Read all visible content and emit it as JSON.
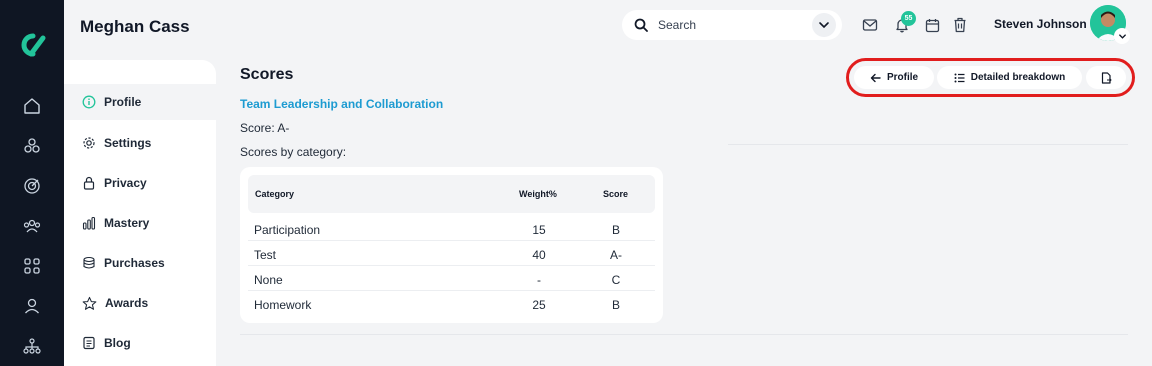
{
  "header": {
    "page_owner": "Meghan Cass",
    "search_placeholder": "Search",
    "notification_count": "55",
    "user_name": "Steven Johnson"
  },
  "subnav": {
    "items": [
      {
        "label": "Profile",
        "icon": "info-icon"
      },
      {
        "label": "Settings",
        "icon": "gear-icon"
      },
      {
        "label": "Privacy",
        "icon": "lock-icon"
      },
      {
        "label": "Mastery",
        "icon": "bar-chart-icon"
      },
      {
        "label": "Purchases",
        "icon": "coins-icon"
      },
      {
        "label": "Awards",
        "icon": "star-icon"
      },
      {
        "label": "Blog",
        "icon": "document-icon"
      }
    ]
  },
  "main": {
    "title": "Scores",
    "course": "Team Leadership and Collaboration",
    "score_line": "Score: A-",
    "category_line": "Scores by category:",
    "table": {
      "headers": [
        "Category",
        "Weight%",
        "Score"
      ],
      "rows": [
        [
          "Participation",
          "15",
          "B"
        ],
        [
          "Test",
          "40",
          "A-"
        ],
        [
          "None",
          "-",
          "C"
        ],
        [
          "Homework",
          "25",
          "B"
        ]
      ]
    }
  },
  "actions": {
    "back_label": "Profile",
    "breakdown_label": "Detailed breakdown"
  },
  "colors": {
    "accent": "#1d9bd1",
    "brand_green": "#22c49a",
    "highlight_red": "#e11d1d",
    "rail_bg": "#0f1623"
  }
}
